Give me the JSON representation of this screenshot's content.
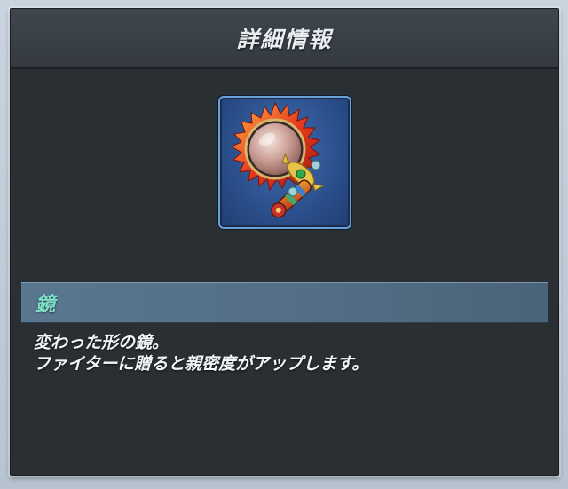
{
  "header": {
    "title": "詳細情報"
  },
  "item": {
    "icon": "hand-mirror-icon",
    "name": "鏡",
    "description_lines": [
      "変わった形の鏡。",
      "ファイターに贈ると親密度がアップします。"
    ]
  },
  "colors": {
    "panel": "#2a2f34",
    "header": "#3a4046",
    "name_bar": "#56728a",
    "name_text": "#7fe0c8",
    "item_bg": "#2b4f8c",
    "item_border": "#6aa0d8"
  }
}
